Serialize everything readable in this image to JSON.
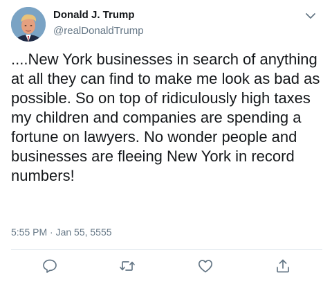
{
  "tweet": {
    "author": {
      "display_name": "Donald J. Trump",
      "handle": "@realDonaldTrump",
      "avatar_icon": "profile-photo"
    },
    "text": "....New York businesses in search of anything at all they can find to make me look as bad as possible. So on top of ridiculously high taxes my children and companies are spending a fortune on lawyers. No wonder people and businesses are fleeing New York in record numbers!",
    "timestamp": "5:55 PM · Jan 55, 5555"
  },
  "menu": {
    "icon": "chevron-down-icon"
  },
  "actions": [
    {
      "name": "reply",
      "icon": "speech-bubble-icon"
    },
    {
      "name": "retweet",
      "icon": "retweet-arrows-icon"
    },
    {
      "name": "like",
      "icon": "heart-icon"
    },
    {
      "name": "share",
      "icon": "share-upload-icon"
    }
  ],
  "colors": {
    "text_primary": "#14171a",
    "text_secondary": "#657786",
    "icon": "#657786",
    "divider": "#e1e8ed"
  }
}
